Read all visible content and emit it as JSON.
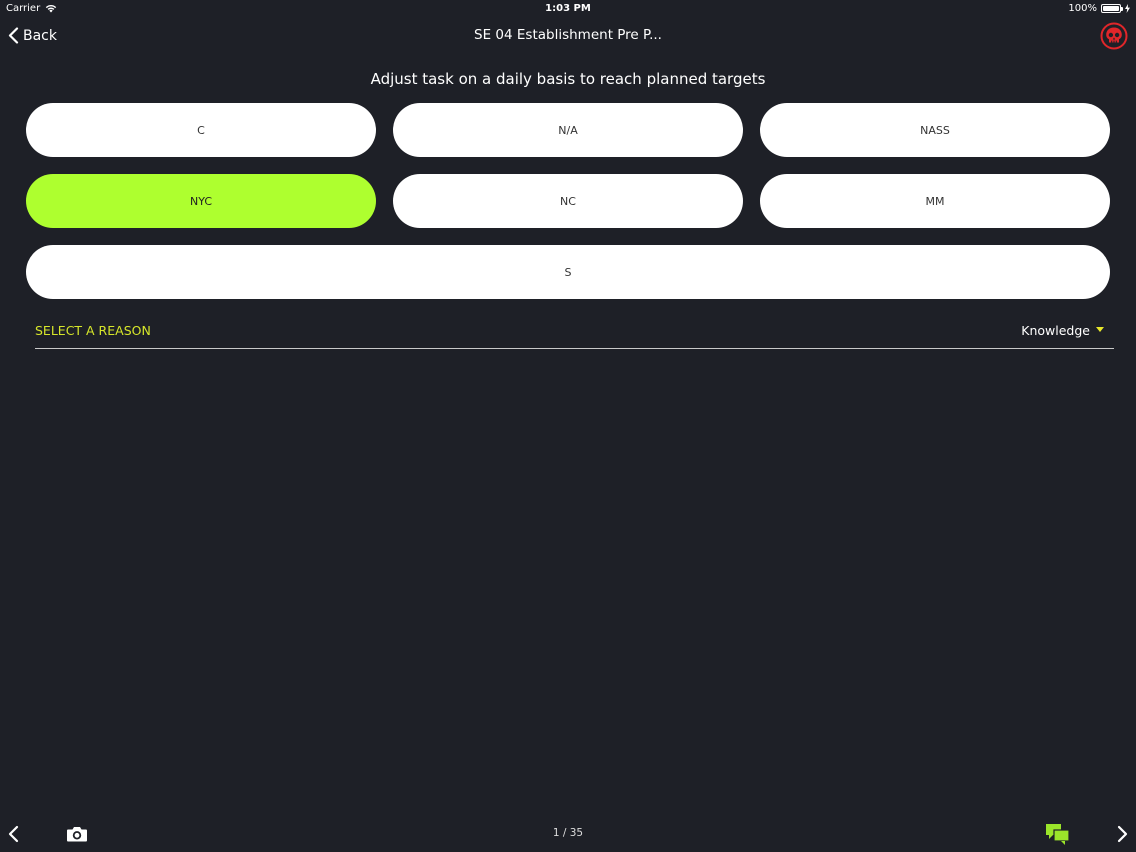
{
  "status_bar": {
    "carrier": "Carrier",
    "time": "1:03 PM",
    "battery": "100%"
  },
  "nav": {
    "back_label": "Back",
    "title": "SE 04 Establishment Pre P..."
  },
  "subtitle": "Adjust task on a daily basis to reach planned targets",
  "options": [
    {
      "label": "C",
      "selected": false
    },
    {
      "label": "N/A",
      "selected": false
    },
    {
      "label": "NASS",
      "selected": false
    },
    {
      "label": "NYC",
      "selected": true
    },
    {
      "label": "NC",
      "selected": false
    },
    {
      "label": "MM",
      "selected": false
    },
    {
      "label": "S",
      "selected": false
    }
  ],
  "reason": {
    "label": "SELECT A REASON",
    "selected_value": "Knowledge"
  },
  "bottom": {
    "page_indicator": "1 / 35"
  },
  "colors": {
    "background": "#1e2027",
    "selected_option": "#aeff2f",
    "reason_label": "#d6e62a",
    "skull_icon": "#e0262a",
    "chat_icon": "#9be52a"
  },
  "icons": {
    "back": "chevron-left-icon",
    "alert": "skull-icon",
    "prev": "chevron-left-icon",
    "camera": "camera-icon",
    "chat": "chat-bubbles-icon",
    "next": "chevron-right-icon"
  }
}
